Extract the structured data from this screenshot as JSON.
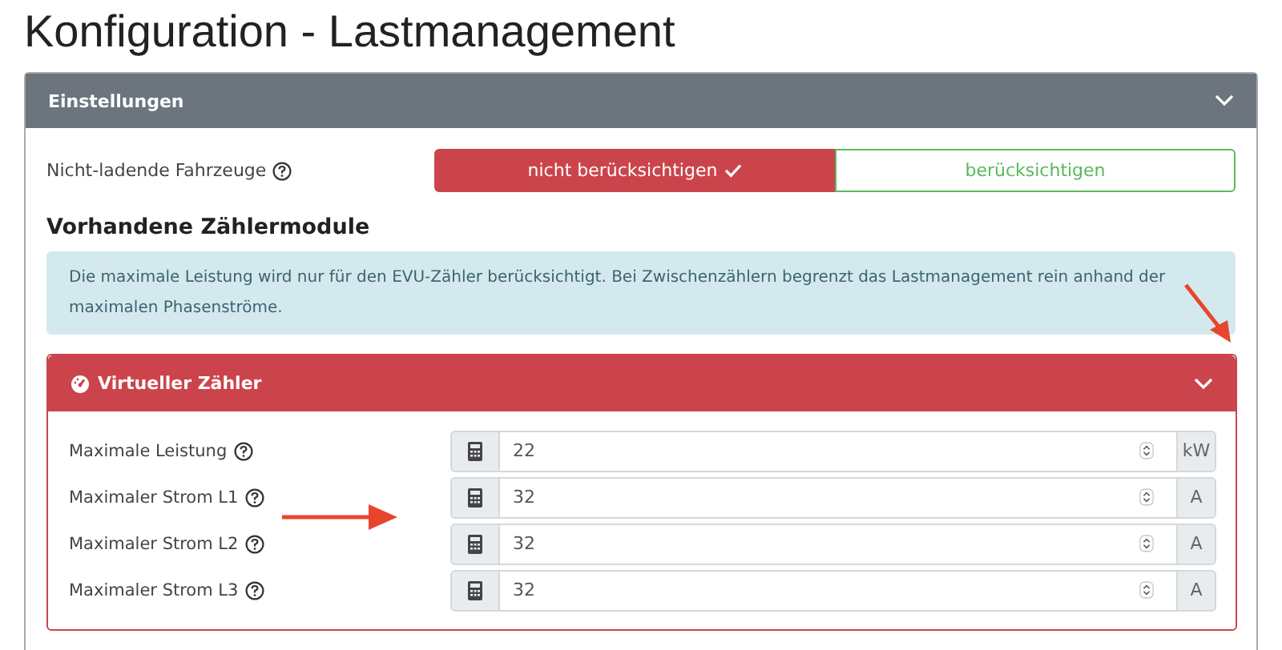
{
  "page_title": "Konfiguration - Lastmanagement",
  "settings_card": {
    "title": "Einstellungen",
    "expanded": true,
    "toggle": {
      "label": "Nicht-ladende Fahrzeuge",
      "options": [
        {
          "label": "nicht berücksichtigen",
          "selected": true,
          "color": "#cc444b"
        },
        {
          "label": "berücksichtigen",
          "selected": false,
          "color": "#5cb85c"
        }
      ]
    },
    "section_heading": "Vorhandene Zählermodule",
    "info_alert": "Die maximale Leistung wird nur für den EVU-Zähler berücksichtigt. Bei Zwischenzählern begrenzt das Lastmanagement rein anhand der maximalen Phasenströme.",
    "meter_card": {
      "title": "Virtueller Zähler",
      "expanded": true,
      "fields": [
        {
          "label": "Maximale Leistung",
          "value": "22",
          "unit": "kW"
        },
        {
          "label": "Maximaler Strom L1",
          "value": "32",
          "unit": "A"
        },
        {
          "label": "Maximaler Strom L2",
          "value": "32",
          "unit": "A"
        },
        {
          "label": "Maximaler Strom L3",
          "value": "32",
          "unit": "A"
        }
      ]
    }
  }
}
